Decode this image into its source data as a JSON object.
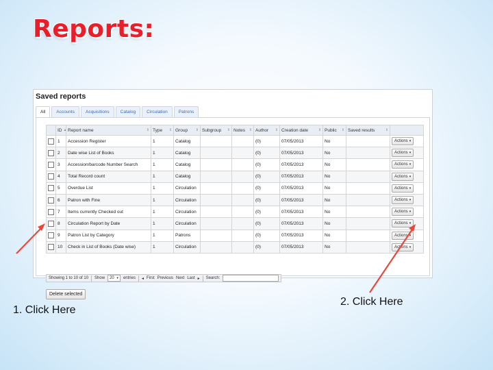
{
  "slide": {
    "title": "Reports:",
    "caption_1": "1. Click Here",
    "caption_2": "2. Click Here",
    "arrow_color": "#e8473c",
    "title_color": "#e81e2a"
  },
  "app": {
    "page_title": "Saved reports",
    "tabs": [
      "All",
      "Accounts",
      "Acquisitions",
      "Catalog",
      "Circulation",
      "Patrons"
    ],
    "active_tab": "All",
    "columns": [
      "",
      "ID",
      "Report name",
      "Type",
      "Group",
      "Subgroup",
      "Notes",
      "Author",
      "Creation date",
      "Public",
      "Saved results",
      ""
    ],
    "rows": [
      {
        "id": "1",
        "name": "Accession Register",
        "type": "1",
        "group": "Catalog",
        "subgroup": "",
        "notes": "",
        "author": "(0)",
        "date": "07/05/2013",
        "public": "No",
        "saved": "",
        "action": "Actions"
      },
      {
        "id": "2",
        "name": "Date wise List of Books",
        "type": "1",
        "group": "Catalog",
        "subgroup": "",
        "notes": "",
        "author": "(0)",
        "date": "07/05/2013",
        "public": "No",
        "saved": "",
        "action": "Actions"
      },
      {
        "id": "3",
        "name": "Accession/barcode Number Search",
        "type": "1",
        "group": "Catalog",
        "subgroup": "",
        "notes": "",
        "author": "(0)",
        "date": "07/05/2013",
        "public": "No",
        "saved": "",
        "action": "Actions"
      },
      {
        "id": "4",
        "name": "Total Record count",
        "type": "1",
        "group": "Catalog",
        "subgroup": "",
        "notes": "",
        "author": "(0)",
        "date": "07/05/2013",
        "public": "No",
        "saved": "",
        "action": "Actions"
      },
      {
        "id": "5",
        "name": "Overdue List",
        "type": "1",
        "group": "Circulation",
        "subgroup": "",
        "notes": "",
        "author": "(0)",
        "date": "07/05/2013",
        "public": "No",
        "saved": "",
        "action": "Actions"
      },
      {
        "id": "6",
        "name": "Patron with Fine",
        "type": "1",
        "group": "Circulation",
        "subgroup": "",
        "notes": "",
        "author": "(0)",
        "date": "07/05/2013",
        "public": "No",
        "saved": "",
        "action": "Actions"
      },
      {
        "id": "7",
        "name": "Items currently Checked out",
        "type": "1",
        "group": "Circulation",
        "subgroup": "",
        "notes": "",
        "author": "(0)",
        "date": "07/05/2013",
        "public": "No",
        "saved": "",
        "action": "Actions"
      },
      {
        "id": "8",
        "name": "Circulation Report by Date",
        "type": "1",
        "group": "Circulation",
        "subgroup": "",
        "notes": "",
        "author": "(0)",
        "date": "07/05/2013",
        "public": "No",
        "saved": "",
        "action": "Actions"
      },
      {
        "id": "9",
        "name": "Patron List by Category",
        "type": "1",
        "group": "Patrons",
        "subgroup": "",
        "notes": "",
        "author": "(0)",
        "date": "07/05/2013",
        "public": "No",
        "saved": "",
        "action": "Actions"
      },
      {
        "id": "10",
        "name": "Check in List of Books (Date wise)",
        "type": "1",
        "group": "Circulation",
        "subgroup": "",
        "notes": "",
        "author": "(0)",
        "date": "07/05/2013",
        "public": "No",
        "saved": "",
        "action": "Actions"
      }
    ],
    "pager": {
      "showing": "Showing 1 to 10 of 10",
      "show_label": "Show",
      "per_page": "20",
      "entries_label": "entries",
      "first": "First",
      "previous": "Previous",
      "next": "Next",
      "last": "Last",
      "search_label": "Search:",
      "search_value": ""
    },
    "delete_label": "Delete selected"
  }
}
